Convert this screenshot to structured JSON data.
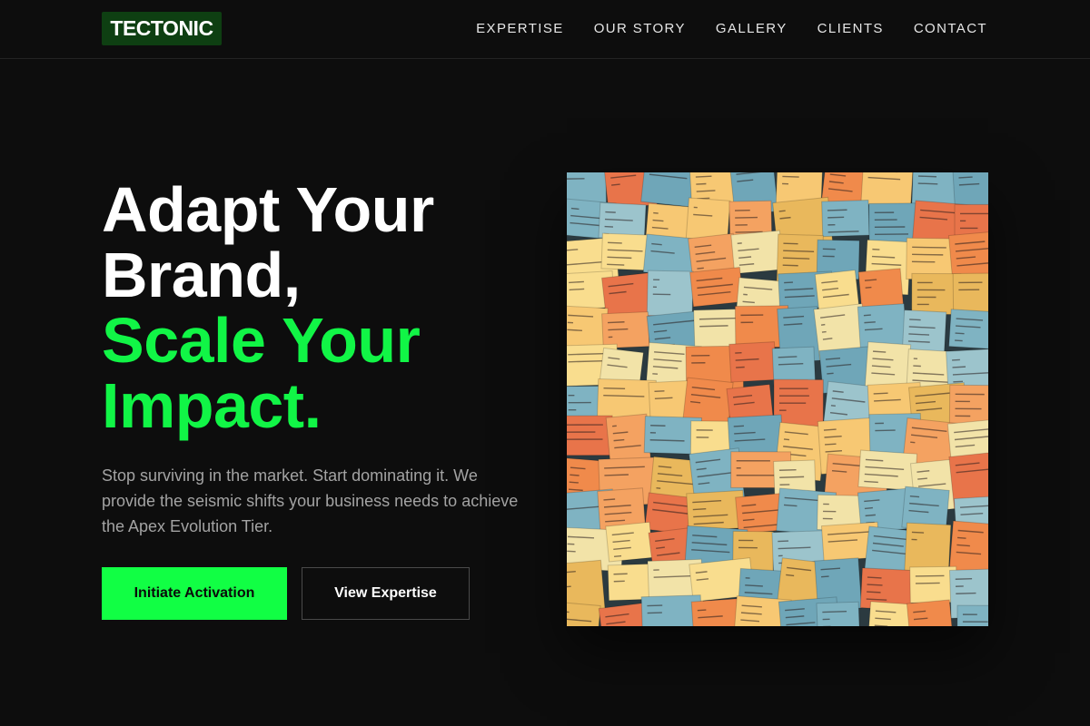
{
  "brand": {
    "name": "TECTONIC"
  },
  "nav": {
    "links": [
      "EXPERTISE",
      "OUR STORY",
      "GALLERY",
      "CLIENTS",
      "CONTACT"
    ]
  },
  "hero": {
    "title_line1": "Adapt Your",
    "title_line2": "Brand,",
    "title_line3": "Scale Your",
    "title_line4": "Impact.",
    "subtitle": "Stop surviving in the market. Start dominating it. We provide the seismic shifts your business needs to achieve the Apex Evolution Tier.",
    "primary_cta": "Initiate Activation",
    "secondary_cta": "View Expertise",
    "image_subject": "wall of colorful sticky notes"
  },
  "colors": {
    "background": "#0d0d0d",
    "accent": "#11ff44",
    "logo_bg": "#0e3f12"
  }
}
